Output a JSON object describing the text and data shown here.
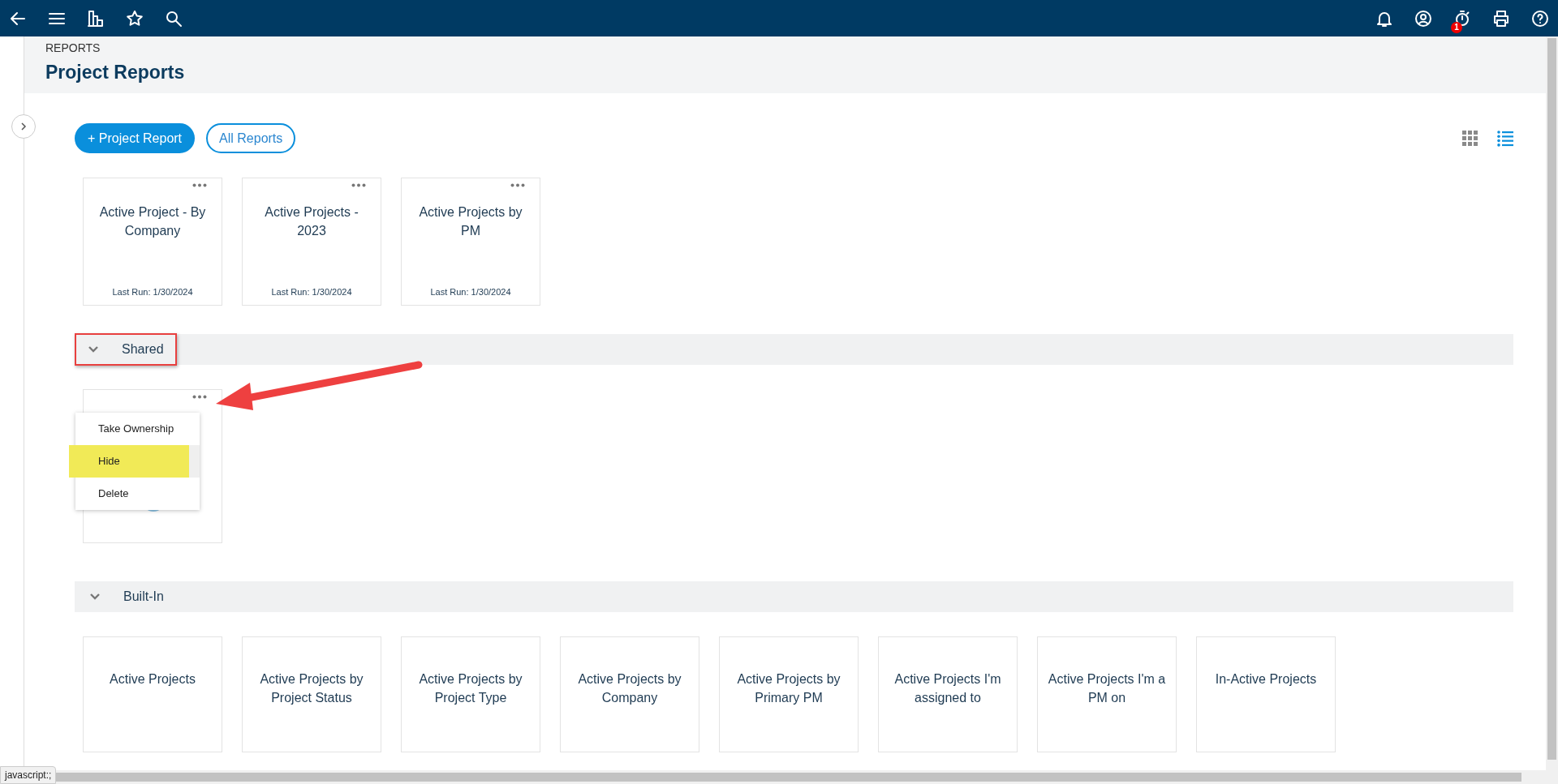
{
  "topbar": {
    "badge": "1"
  },
  "header": {
    "breadcrumb": "REPORTS",
    "title": "Project Reports"
  },
  "actions": [
    {
      "label": "+ Project Report",
      "kind": "primary"
    },
    {
      "label": "All Reports",
      "kind": "outline"
    }
  ],
  "view_toggle": [
    {
      "kind": "grid",
      "selected": false
    },
    {
      "kind": "list",
      "selected": true
    }
  ],
  "my_reports": [
    {
      "title": "Active Project - By Company",
      "last_run": "Last Run: 1/30/2024"
    },
    {
      "title": "Active Projects - 2023",
      "last_run": "Last Run: 1/30/2024"
    },
    {
      "title": "Active Projects by PM",
      "last_run": "Last Run: 1/30/2024"
    }
  ],
  "sections": [
    {
      "title": "Shared",
      "expanded": true,
      "outlined": true,
      "pointer_arrow": true,
      "reports": [
        {
          "menu": [
            {
              "label": "Take Ownership",
              "highlighted": false
            },
            {
              "label": "Hide",
              "highlighted": true
            },
            {
              "label": "Delete",
              "highlighted": false
            }
          ]
        }
      ]
    },
    {
      "title": "Built-In",
      "expanded": true,
      "outlined": false,
      "pointer_arrow": false,
      "reports": [
        {
          "title": "Active Projects"
        },
        {
          "title": "Active Projects by Project Status"
        },
        {
          "title": "Active Projects by Project Type"
        },
        {
          "title": "Active Projects by Company"
        },
        {
          "title": "Active Projects by Primary PM"
        },
        {
          "title": "Active Projects I'm assigned to"
        },
        {
          "title": "Active Projects I'm a PM on"
        },
        {
          "title": "In-Active Projects"
        }
      ]
    }
  ],
  "status_tooltip": "javascript:;"
}
